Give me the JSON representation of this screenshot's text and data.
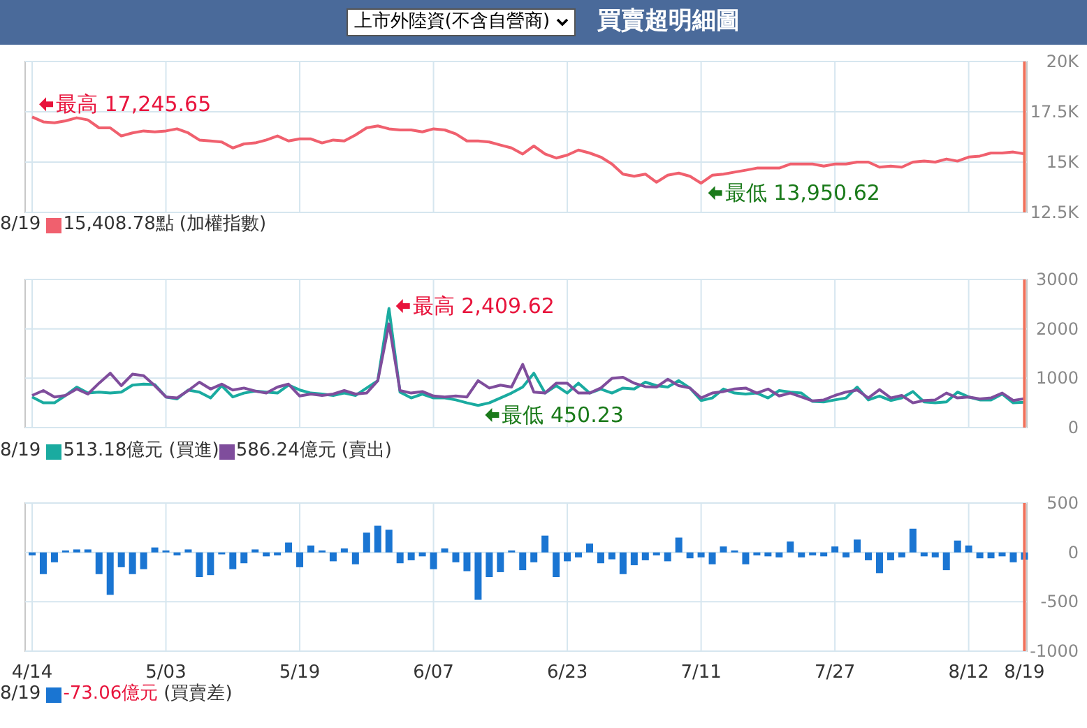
{
  "header": {
    "select": {
      "value": "上市外陸資(不含自營商)"
    },
    "title": "買賣超明細圖"
  },
  "panels": [
    {
      "chart_data": {
        "type": "line",
        "grid": true,
        "ylim": [
          12500,
          20000
        ],
        "yticks": [
          {
            "value": 20000,
            "label": "20K"
          },
          {
            "value": 17500,
            "label": "17.5K"
          },
          {
            "value": 15000,
            "label": "15K"
          },
          {
            "value": 12500,
            "label": "12.5K"
          }
        ],
        "series": [
          {
            "name": "(加權指數)",
            "color": "#f0606e",
            "values": [
              17246,
              17000,
              16950,
              17050,
              17200,
              17100,
              16700,
              16700,
              16300,
              16450,
              16550,
              16500,
              16550,
              16650,
              16450,
              16100,
              16050,
              16000,
              15700,
              15900,
              15950,
              16100,
              16300,
              16050,
              16150,
              16150,
              15950,
              16100,
              16050,
              16350,
              16700,
              16800,
              16650,
              16600,
              16600,
              16500,
              16650,
              16600,
              16400,
              16050,
              16050,
              16000,
              15850,
              15700,
              15400,
              15800,
              15400,
              15200,
              15350,
              15600,
              15450,
              15250,
              14900,
              14400,
              14300,
              14400,
              14000,
              14350,
              14450,
              14300,
              13951,
              14350,
              14400,
              14500,
              14600,
              14700,
              14700,
              14700,
              14900,
              14900,
              14900,
              14800,
              14900,
              14900,
              15000,
              15000,
              14750,
              14800,
              14750,
              15000,
              15050,
              15000,
              15150,
              15050,
              15250,
              15300,
              15450,
              15450,
              15500,
              15409
            ]
          }
        ]
      },
      "markers": [
        {
          "kind": "max",
          "text": "最高 17,245.65"
        },
        {
          "kind": "min",
          "text": "最低 13,950.62"
        }
      ],
      "legend": {
        "date": "8/19",
        "items": [
          {
            "value": "15,408.78點",
            "negative": false
          }
        ]
      }
    },
    {
      "chart_data": {
        "type": "line",
        "grid": true,
        "ylim": [
          0,
          3000
        ],
        "yticks": [
          3000,
          2000,
          1000,
          0
        ],
        "series": [
          {
            "name": "(買進)",
            "color": "#1aaba0",
            "values": [
              620,
              500,
              500,
              650,
              820,
              700,
              720,
              700,
              720,
              860,
              880,
              870,
              620,
              580,
              760,
              720,
              600,
              850,
              620,
              700,
              740,
              720,
              700,
              860,
              760,
              700,
              680,
              650,
              700,
              650,
              800,
              950,
              2410,
              720,
              600,
              680,
              600,
              600,
              560,
              500,
              450,
              500,
              600,
              700,
              820,
              1100,
              700,
              850,
              700,
              900,
              700,
              780,
              700,
              800,
              780,
              920,
              850,
              820,
              950,
              800,
              550,
              600,
              780,
              700,
              680,
              700,
              600,
              750,
              720,
              700,
              530,
              520,
              560,
              600,
              820,
              560,
              640,
              550,
              600,
              730,
              520,
              500,
              520,
              720,
              620,
              560,
              560,
              680,
              500,
              513
            ]
          },
          {
            "name": "(賣出)",
            "color": "#7f4d9c",
            "values": [
              650,
              750,
              620,
              650,
              780,
              680,
              900,
              1100,
              850,
              1080,
              1050,
              850,
              620,
              600,
              750,
              920,
              780,
              880,
              760,
              800,
              740,
              700,
              820,
              880,
              640,
              680,
              650,
              680,
              750,
              680,
              700,
              950,
              2100,
              750,
              700,
              730,
              640,
              620,
              640,
              620,
              950,
              800,
              860,
              820,
              1280,
              720,
              700,
              900,
              900,
              700,
              700,
              800,
              1000,
              1020,
              900,
              830,
              820,
              980,
              850,
              800,
              600,
              700,
              730,
              780,
              800,
              700,
              780,
              640,
              700,
              620,
              540,
              560,
              650,
              720,
              760,
              600,
              770,
              600,
              650,
              500,
              550,
              560,
              700,
              600,
              620,
              580,
              600,
              700,
              550,
              586
            ]
          }
        ]
      },
      "markers": [
        {
          "kind": "max",
          "text": "最高 2,409.62"
        },
        {
          "kind": "min",
          "text": "最低 450.23"
        }
      ],
      "legend": {
        "date": "8/19",
        "items": [
          {
            "value": "513.18億元",
            "negative": false
          },
          {
            "value": "586.24億元",
            "negative": false
          }
        ]
      }
    },
    {
      "chart_data": {
        "type": "bar",
        "grid": true,
        "ylim": [
          -1000,
          500
        ],
        "yticks": [
          500,
          0,
          -500,
          -1000
        ],
        "series": [
          {
            "name": "(買賣差)",
            "color": "#1a75d2",
            "values": [
              -30,
              -220,
              -100,
              20,
              30,
              30,
              -220,
              -430,
              -150,
              -220,
              -170,
              50,
              20,
              -30,
              30,
              -250,
              -230,
              -20,
              -170,
              -110,
              30,
              -40,
              -30,
              100,
              -150,
              70,
              20,
              -90,
              40,
              -120,
              200,
              270,
              230,
              -110,
              -80,
              -40,
              -170,
              40,
              -100,
              -190,
              -480,
              -250,
              -200,
              20,
              -180,
              -100,
              170,
              -250,
              -90,
              -50,
              90,
              -110,
              -70,
              -220,
              -130,
              -80,
              -30,
              -90,
              150,
              -60,
              -50,
              -120,
              60,
              20,
              -120,
              -30,
              -40,
              -50,
              110,
              -50,
              -30,
              -40,
              60,
              -50,
              130,
              -80,
              -210,
              -80,
              -50,
              240,
              -40,
              -50,
              -180,
              120,
              70,
              -60,
              -60,
              -40,
              -100,
              -73
            ]
          }
        ]
      },
      "date_labels": [
        "4/14",
        "5/03",
        "5/19",
        "6/07",
        "6/23",
        "7/11",
        "7/27",
        "8/12",
        "8/19"
      ],
      "legend": {
        "date": "8/19",
        "items": [
          {
            "value": "-73.06億元",
            "negative": true
          }
        ]
      }
    }
  ]
}
